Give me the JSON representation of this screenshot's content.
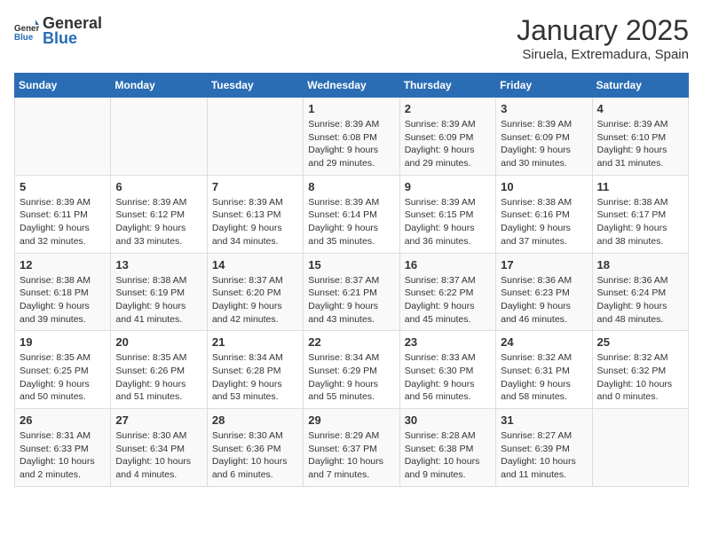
{
  "header": {
    "logo_general": "General",
    "logo_blue": "Blue",
    "month_title": "January 2025",
    "location": "Siruela, Extremadura, Spain"
  },
  "weekdays": [
    "Sunday",
    "Monday",
    "Tuesday",
    "Wednesday",
    "Thursday",
    "Friday",
    "Saturday"
  ],
  "weeks": [
    [
      {
        "day": "",
        "info": ""
      },
      {
        "day": "",
        "info": ""
      },
      {
        "day": "",
        "info": ""
      },
      {
        "day": "1",
        "info": "Sunrise: 8:39 AM\nSunset: 6:08 PM\nDaylight: 9 hours and 29 minutes."
      },
      {
        "day": "2",
        "info": "Sunrise: 8:39 AM\nSunset: 6:09 PM\nDaylight: 9 hours and 29 minutes."
      },
      {
        "day": "3",
        "info": "Sunrise: 8:39 AM\nSunset: 6:09 PM\nDaylight: 9 hours and 30 minutes."
      },
      {
        "day": "4",
        "info": "Sunrise: 8:39 AM\nSunset: 6:10 PM\nDaylight: 9 hours and 31 minutes."
      }
    ],
    [
      {
        "day": "5",
        "info": "Sunrise: 8:39 AM\nSunset: 6:11 PM\nDaylight: 9 hours and 32 minutes."
      },
      {
        "day": "6",
        "info": "Sunrise: 8:39 AM\nSunset: 6:12 PM\nDaylight: 9 hours and 33 minutes."
      },
      {
        "day": "7",
        "info": "Sunrise: 8:39 AM\nSunset: 6:13 PM\nDaylight: 9 hours and 34 minutes."
      },
      {
        "day": "8",
        "info": "Sunrise: 8:39 AM\nSunset: 6:14 PM\nDaylight: 9 hours and 35 minutes."
      },
      {
        "day": "9",
        "info": "Sunrise: 8:39 AM\nSunset: 6:15 PM\nDaylight: 9 hours and 36 minutes."
      },
      {
        "day": "10",
        "info": "Sunrise: 8:38 AM\nSunset: 6:16 PM\nDaylight: 9 hours and 37 minutes."
      },
      {
        "day": "11",
        "info": "Sunrise: 8:38 AM\nSunset: 6:17 PM\nDaylight: 9 hours and 38 minutes."
      }
    ],
    [
      {
        "day": "12",
        "info": "Sunrise: 8:38 AM\nSunset: 6:18 PM\nDaylight: 9 hours and 39 minutes."
      },
      {
        "day": "13",
        "info": "Sunrise: 8:38 AM\nSunset: 6:19 PM\nDaylight: 9 hours and 41 minutes."
      },
      {
        "day": "14",
        "info": "Sunrise: 8:37 AM\nSunset: 6:20 PM\nDaylight: 9 hours and 42 minutes."
      },
      {
        "day": "15",
        "info": "Sunrise: 8:37 AM\nSunset: 6:21 PM\nDaylight: 9 hours and 43 minutes."
      },
      {
        "day": "16",
        "info": "Sunrise: 8:37 AM\nSunset: 6:22 PM\nDaylight: 9 hours and 45 minutes."
      },
      {
        "day": "17",
        "info": "Sunrise: 8:36 AM\nSunset: 6:23 PM\nDaylight: 9 hours and 46 minutes."
      },
      {
        "day": "18",
        "info": "Sunrise: 8:36 AM\nSunset: 6:24 PM\nDaylight: 9 hours and 48 minutes."
      }
    ],
    [
      {
        "day": "19",
        "info": "Sunrise: 8:35 AM\nSunset: 6:25 PM\nDaylight: 9 hours and 50 minutes."
      },
      {
        "day": "20",
        "info": "Sunrise: 8:35 AM\nSunset: 6:26 PM\nDaylight: 9 hours and 51 minutes."
      },
      {
        "day": "21",
        "info": "Sunrise: 8:34 AM\nSunset: 6:28 PM\nDaylight: 9 hours and 53 minutes."
      },
      {
        "day": "22",
        "info": "Sunrise: 8:34 AM\nSunset: 6:29 PM\nDaylight: 9 hours and 55 minutes."
      },
      {
        "day": "23",
        "info": "Sunrise: 8:33 AM\nSunset: 6:30 PM\nDaylight: 9 hours and 56 minutes."
      },
      {
        "day": "24",
        "info": "Sunrise: 8:32 AM\nSunset: 6:31 PM\nDaylight: 9 hours and 58 minutes."
      },
      {
        "day": "25",
        "info": "Sunrise: 8:32 AM\nSunset: 6:32 PM\nDaylight: 10 hours and 0 minutes."
      }
    ],
    [
      {
        "day": "26",
        "info": "Sunrise: 8:31 AM\nSunset: 6:33 PM\nDaylight: 10 hours and 2 minutes."
      },
      {
        "day": "27",
        "info": "Sunrise: 8:30 AM\nSunset: 6:34 PM\nDaylight: 10 hours and 4 minutes."
      },
      {
        "day": "28",
        "info": "Sunrise: 8:30 AM\nSunset: 6:36 PM\nDaylight: 10 hours and 6 minutes."
      },
      {
        "day": "29",
        "info": "Sunrise: 8:29 AM\nSunset: 6:37 PM\nDaylight: 10 hours and 7 minutes."
      },
      {
        "day": "30",
        "info": "Sunrise: 8:28 AM\nSunset: 6:38 PM\nDaylight: 10 hours and 9 minutes."
      },
      {
        "day": "31",
        "info": "Sunrise: 8:27 AM\nSunset: 6:39 PM\nDaylight: 10 hours and 11 minutes."
      },
      {
        "day": "",
        "info": ""
      }
    ]
  ]
}
